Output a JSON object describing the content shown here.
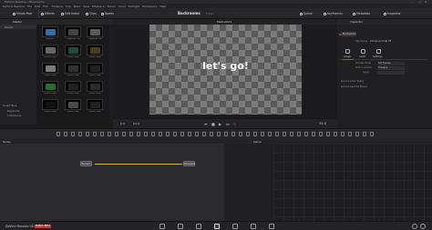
{
  "window": {
    "title": "DaVinci Resolve - Backrooms",
    "controls": [
      "–",
      "□",
      "✕"
    ]
  },
  "menu": [
    "DaVinci Resolve",
    "File",
    "Edit",
    "Trim",
    "Timeline",
    "Clip",
    "Mark",
    "View",
    "Playback",
    "Fusion",
    "Color",
    "Fairlight",
    "Workspace",
    "Help"
  ],
  "toolbar": {
    "media_pool": "Media Pool",
    "effects": "Effects",
    "edit_index": "Edit Index",
    "clips": "Clips",
    "nodes": "Nodes",
    "project_title": "Backrooms",
    "project_status": "Edited",
    "spline": "Spline",
    "keyframes": "Keyframes",
    "metadata": "Metadata",
    "inspector": "Inspector"
  },
  "media_pool": {
    "header": "Master",
    "bins": [
      {
        "label": "Master",
        "selected": true
      },
      {
        "label": "Smart Bins",
        "selected": false
      },
      {
        "label": "Keywords",
        "selected": false
      },
      {
        "label": "Collections",
        "selected": false
      }
    ],
    "thumbnails": [
      {
        "label": "Timeline 1",
        "color": "#3c6aa8"
      },
      {
        "label": "Compound Clip",
        "color": "#444"
      },
      {
        "label": "Compound Clip",
        "color": "#5a5a5a"
      },
      {
        "label": "Fusion Comp",
        "color": "#666"
      },
      {
        "label": "Fusion Comp",
        "color": "#1e4a3a"
      },
      {
        "label": "Fusion Comp",
        "color": "#4f3a24"
      },
      {
        "label": "Fusion Comp",
        "color": "#7a7a7a"
      },
      {
        "label": "Fusion Comp",
        "color": "#313131"
      },
      {
        "label": "Fusion Comp",
        "color": "#222"
      },
      {
        "label": "Fusion Comp",
        "color": "#2b6c2b"
      },
      {
        "label": "Fusion Comp",
        "color": "#222"
      },
      {
        "label": "Fusion Comp",
        "color": "#2b2b2b"
      },
      {
        "label": "Fusion Comp",
        "color": "#111"
      },
      {
        "label": "Fusion Comp",
        "color": "#4b4b4b"
      },
      {
        "label": "Fusion Comp",
        "color": "#222"
      }
    ]
  },
  "viewer": {
    "header": "MediaOut1",
    "text": "let's go!",
    "timecode": "31.0",
    "frame_start": "0.0",
    "frame_end": "64.0"
  },
  "inspector": {
    "header": "Inspector",
    "tab_label": "MediaOut1",
    "clip_name_label": "Clip Name",
    "clip_name": "Compound Clip 78",
    "tabs": [
      "Image",
      "Audio",
      "Settings"
    ],
    "rows": [
      {
        "label": "Process Mode",
        "value": "Full Frames"
      },
      {
        "label": "Motion Source",
        "value": "Timeline"
      },
      {
        "label": "Layer",
        "value": ""
      }
    ],
    "sections": [
      "Source Color Space",
      "Source Gamma Space"
    ]
  },
  "nodes": {
    "header": "Nodes",
    "items": [
      "MediaIn1",
      "MediaOut1"
    ]
  },
  "spline": {
    "header": "Spline"
  },
  "status": {
    "app": "DaVinci Resolve 18.5",
    "badge": "PUBLIC BETA"
  },
  "colors": {
    "accent": "#d23b3b",
    "link": "#d8b43a",
    "bg": "#1b1b1d"
  }
}
